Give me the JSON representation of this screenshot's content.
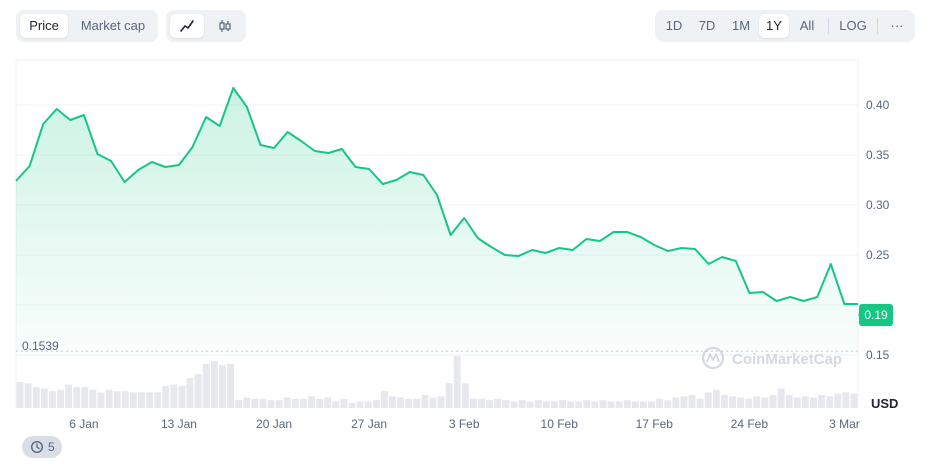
{
  "toolbar": {
    "metric_tabs": [
      {
        "label": "Price",
        "active": true
      },
      {
        "label": "Market cap",
        "active": false
      }
    ],
    "chart_type_icons": [
      "line-chart-icon",
      "candlestick-icon"
    ],
    "ranges": [
      {
        "label": "1D",
        "active": false
      },
      {
        "label": "7D",
        "active": false
      },
      {
        "label": "1M",
        "active": false
      },
      {
        "label": "1Y",
        "active": true
      },
      {
        "label": "All",
        "active": false
      }
    ],
    "log_label": "LOG",
    "more_label": "···"
  },
  "watermark": "CoinMarketCap",
  "currency_label": "USD",
  "current_price_label": "0.19",
  "low_label": "0.1539",
  "history_badge": "5",
  "colors": {
    "line": "#16c784",
    "badge_bg": "#16c784",
    "grid": "#eff2f5",
    "volume": "#e6e8ee",
    "text": "#58667e"
  },
  "chart_data": {
    "type": "area",
    "title": "",
    "xlabel": "",
    "ylabel": "USD",
    "x_ticks": [
      "6 Jan",
      "13 Jan",
      "20 Jan",
      "27 Jan",
      "3 Feb",
      "10 Feb",
      "17 Feb",
      "24 Feb",
      "3 Mar"
    ],
    "y_ticks": [
      0.15,
      0.2,
      0.25,
      0.3,
      0.35,
      0.4
    ],
    "y_tick_labels": [
      "0.15",
      "",
      "0.25",
      "0.30",
      "0.35",
      "0.40"
    ],
    "ylim": [
      0.15,
      0.445
    ],
    "x_start_date": "2025-01-01",
    "grid": true,
    "series": [
      {
        "values": [
          0.324,
          0.339,
          0.381,
          0.396,
          0.385,
          0.39,
          0.351,
          0.344,
          0.323,
          0.335,
          0.343,
          0.338,
          0.34,
          0.358,
          0.388,
          0.379,
          0.417,
          0.398,
          0.36,
          0.357,
          0.373,
          0.364,
          0.354,
          0.352,
          0.356,
          0.338,
          0.336,
          0.321,
          0.325,
          0.333,
          0.33,
          0.31,
          0.27,
          0.287,
          0.267,
          0.258,
          0.25,
          0.249,
          0.255,
          0.252,
          0.257,
          0.255,
          0.266,
          0.264,
          0.273,
          0.273,
          0.268,
          0.26,
          0.254,
          0.257,
          0.256,
          0.241,
          0.248,
          0.244,
          0.212,
          0.213,
          0.204,
          0.208,
          0.204,
          0.208,
          0.241,
          0.201,
          0.201
        ]
      }
    ],
    "volume": [
      20,
      19,
      16,
      15,
      13,
      14,
      18,
      16,
      16,
      14,
      12,
      14,
      13,
      13,
      12,
      12,
      12,
      12,
      17,
      18,
      17,
      23,
      26,
      34,
      36,
      33,
      34,
      6,
      8,
      7,
      7,
      6,
      6,
      8,
      7,
      7,
      9,
      7,
      8,
      5,
      7,
      4,
      5,
      5,
      6,
      13,
      9,
      8,
      7,
      7,
      10,
      8,
      9,
      19,
      40,
      19,
      7,
      7,
      6,
      7,
      6,
      5,
      6,
      5,
      6,
      5,
      5,
      6,
      5,
      5,
      6,
      5,
      6,
      5,
      5,
      6,
      5,
      5,
      5,
      7,
      6,
      8,
      9,
      10,
      7,
      12,
      14,
      10,
      9,
      8,
      7,
      9,
      8,
      10,
      15,
      10,
      8,
      9,
      8,
      10,
      9,
      11,
      12,
      11
    ],
    "current_value": 0.19,
    "low_value": 0.1539
  }
}
